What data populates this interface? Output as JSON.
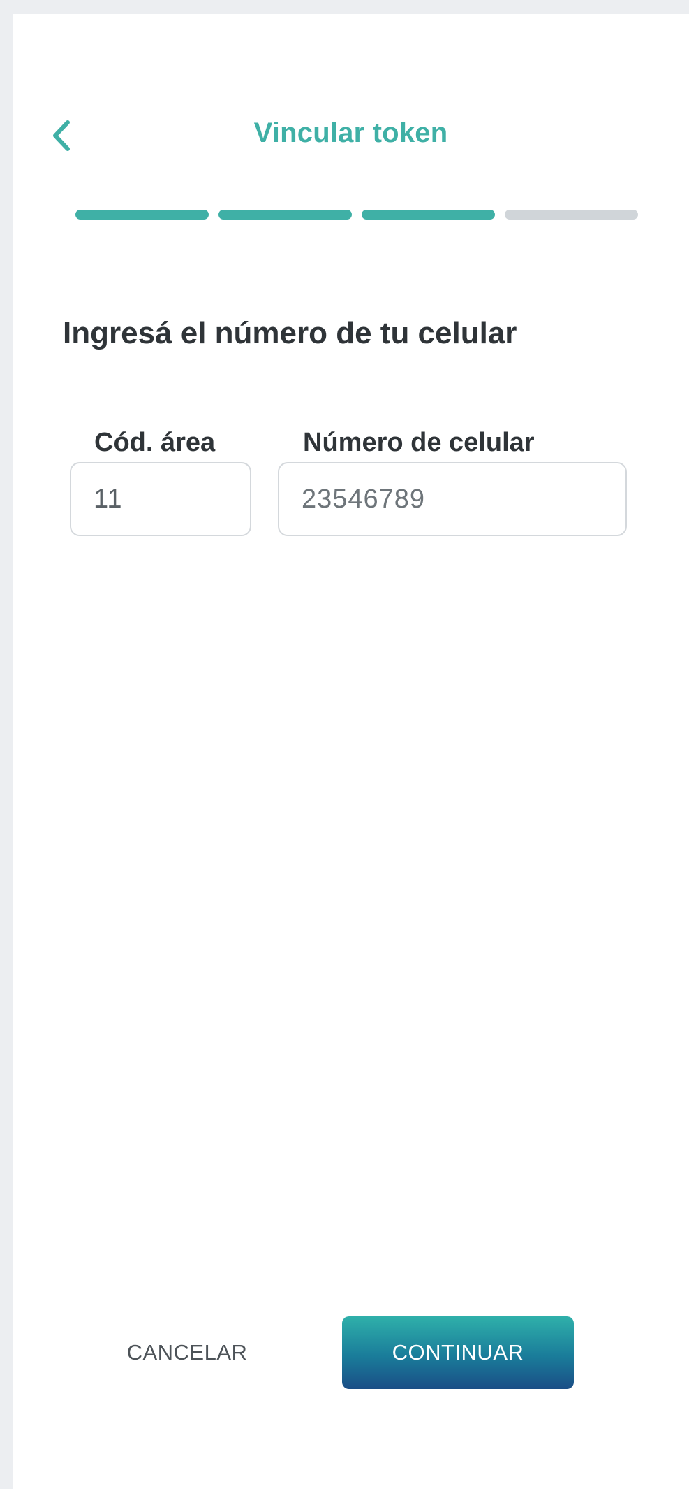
{
  "header": {
    "title": "Vincular token",
    "back_icon": "chevron-left-icon"
  },
  "stepper": {
    "total_steps": 4,
    "completed_steps": 3,
    "active_color": "#3fb0a6",
    "inactive_color": "#d0d5d9"
  },
  "form": {
    "heading": "Ingresá el número de tu celular",
    "area_code": {
      "label": "Cód. área",
      "value": "11"
    },
    "phone_number": {
      "label": "Número de celular",
      "placeholder": "23546789"
    }
  },
  "actions": {
    "cancel_label": "CANCELAR",
    "continue_label": "CONTINUAR"
  },
  "colors": {
    "accent": "#3fb0a6",
    "button_gradient_top": "#2fb0aa",
    "button_gradient_bottom": "#1a4e86"
  }
}
